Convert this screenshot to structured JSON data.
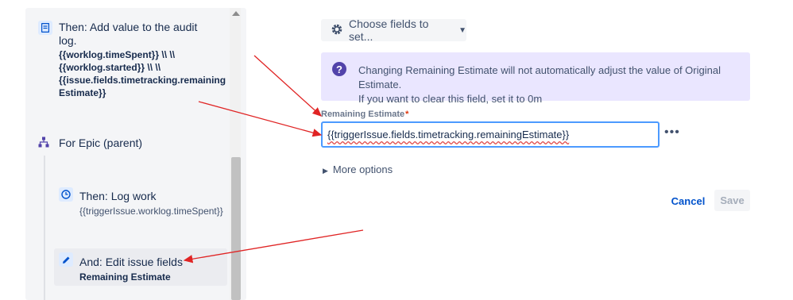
{
  "rule_panel": {
    "audit_action": {
      "title": "Then: Add value to the audit log.",
      "detail_lines": [
        "{{worklog.timeSpent}} \\\\ \\\\",
        "{{worklog.started}} \\\\ \\\\",
        "{{issue.fields.timetracking.remaining",
        "Estimate}}"
      ]
    },
    "branch": {
      "title": "For Epic (parent)"
    },
    "log_work_action": {
      "title": "Then: Log work",
      "detail": "{{triggerIssue.worklog.timeSpent}}"
    },
    "edit_action": {
      "title": "And: Edit issue fields",
      "detail": "Remaining Estimate"
    }
  },
  "config": {
    "choose_fields_label": "Choose fields to set...",
    "info_line1": "Changing Remaining Estimate will not automatically adjust the value of Original Estimate.",
    "info_line2": "If you want to clear this field, set it to 0m",
    "field_label": "Remaining Estimate",
    "required_mark": "*",
    "field_value": "{{triggerIssue.fields.timetracking.remainingEstimate}}",
    "more_dots": "•••",
    "more_options_label": "More options",
    "cancel_label": "Cancel",
    "save_label": "Save"
  },
  "colors": {
    "annotation_arrow": "#e02424",
    "info_background": "#eae6ff",
    "link_blue": "#0052cc"
  }
}
